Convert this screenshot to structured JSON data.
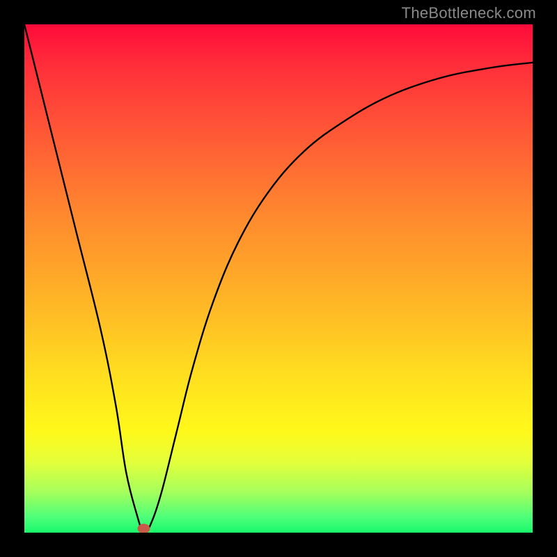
{
  "watermark": "TheBottleneck.com",
  "chart_data": {
    "type": "line",
    "title": "",
    "xlabel": "",
    "ylabel": "",
    "xlim": [
      0,
      100
    ],
    "ylim": [
      0,
      100
    ],
    "series": [
      {
        "name": "bottleneck-curve",
        "x": [
          0,
          5,
          10,
          15,
          18,
          20,
          22,
          23.5,
          25,
          27,
          30,
          33,
          37,
          42,
          48,
          55,
          63,
          72,
          82,
          92,
          100
        ],
        "values": [
          100,
          80,
          60,
          40,
          25,
          12,
          4,
          0,
          2,
          8,
          20,
          32,
          45,
          57,
          67,
          75,
          81,
          86,
          89.5,
          91.5,
          92.5
        ]
      }
    ],
    "marker": {
      "x": 23.5,
      "y": 0.8,
      "color": "#c85a4a",
      "rx": 9,
      "ry": 7
    },
    "gradient_stops": [
      {
        "pos": 0,
        "color": "#ff0a3a"
      },
      {
        "pos": 8,
        "color": "#ff2e3a"
      },
      {
        "pos": 22,
        "color": "#ff5a36"
      },
      {
        "pos": 38,
        "color": "#ff8a2e"
      },
      {
        "pos": 55,
        "color": "#ffb726"
      },
      {
        "pos": 70,
        "color": "#ffe11f"
      },
      {
        "pos": 80,
        "color": "#fff81a"
      },
      {
        "pos": 86,
        "color": "#e4ff3a"
      },
      {
        "pos": 92,
        "color": "#a6ff5c"
      },
      {
        "pos": 97,
        "color": "#4dff7a"
      },
      {
        "pos": 100,
        "color": "#18f96b"
      }
    ]
  }
}
